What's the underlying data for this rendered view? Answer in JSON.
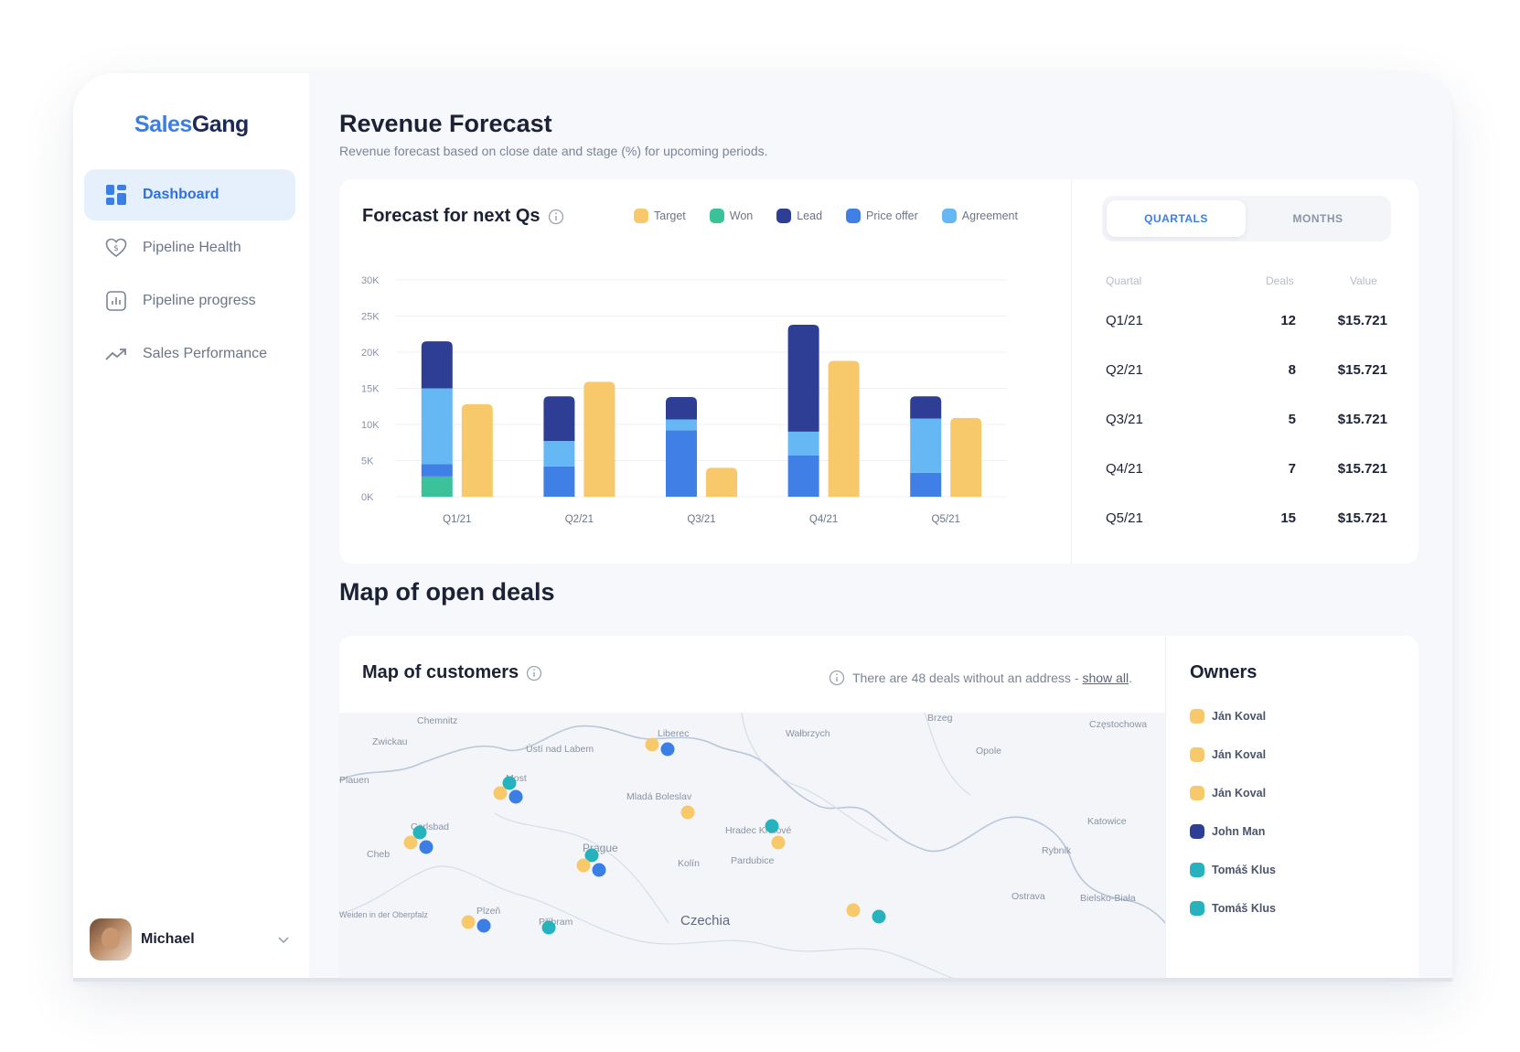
{
  "brand": {
    "part1": "Sales",
    "part2": "Gang"
  },
  "nav": [
    {
      "label": "Dashboard",
      "icon": "dashboard-icon",
      "active": true
    },
    {
      "label": "Pipeline Health",
      "icon": "heart-dollar-icon",
      "active": false
    },
    {
      "label": "Pipeline progress",
      "icon": "bar-chart-icon",
      "active": false
    },
    {
      "label": "Sales Performance",
      "icon": "trend-up-icon",
      "active": false
    }
  ],
  "user": {
    "name": "Michael"
  },
  "page": {
    "title": "Revenue Forecast",
    "subtitle": "Revenue forecast based on close date and stage (%) for upcoming periods."
  },
  "forecast": {
    "title": "Forecast for next Qs",
    "legend": [
      {
        "label": "Target",
        "color": "#f8c96b"
      },
      {
        "label": "Won",
        "color": "#3cc29a"
      },
      {
        "label": "Lead",
        "color": "#2f3e95"
      },
      {
        "label": "Price offer",
        "color": "#3f7fe6"
      },
      {
        "label": "Agreement",
        "color": "#66b8f5"
      }
    ],
    "toggle": {
      "on": "QUARTALS",
      "off": "MONTHS"
    },
    "table": {
      "headers": [
        "Quartal",
        "Deals",
        "Value"
      ],
      "rows": [
        {
          "q": "Q1/21",
          "deals": "12",
          "value": "$15.721"
        },
        {
          "q": "Q2/21",
          "deals": "8",
          "value": "$15.721"
        },
        {
          "q": "Q3/21",
          "deals": "5",
          "value": "$15.721"
        },
        {
          "q": "Q4/21",
          "deals": "7",
          "value": "$15.721"
        },
        {
          "q": "Q5/21",
          "deals": "15",
          "value": "$15.721"
        }
      ]
    }
  },
  "chart_data": {
    "type": "bar",
    "title": "Forecast for next Qs",
    "categories": [
      "Q1/21",
      "Q2/21",
      "Q3/21",
      "Q4/21",
      "Q5/21"
    ],
    "ytick_labels": [
      "0K",
      "5K",
      "10K",
      "15K",
      "20K",
      "25K",
      "30K"
    ],
    "ylim": [
      0,
      30000
    ],
    "stacked_series": [
      {
        "name": "Won",
        "color": "#3cc29a",
        "values": [
          2800,
          0,
          0,
          0,
          0
        ]
      },
      {
        "name": "Price offer",
        "color": "#3f7fe6",
        "values": [
          1700,
          4200,
          9200,
          5700,
          3300
        ]
      },
      {
        "name": "Agreement",
        "color": "#66b8f5",
        "values": [
          10500,
          3500,
          1500,
          3300,
          7500
        ]
      },
      {
        "name": "Lead",
        "color": "#2f3e95",
        "values": [
          6500,
          6200,
          3100,
          14800,
          3100
        ]
      }
    ],
    "target_series": {
      "name": "Target",
      "color": "#f8c96b",
      "values": [
        12800,
        15900,
        4000,
        18800,
        10900
      ]
    },
    "grid": true
  },
  "map": {
    "section_title": "Map of open deals",
    "card_title": "Map of customers",
    "note": "There are 48 deals without an address -",
    "note_link": "show all",
    "note_end": ".",
    "places": [
      "Chemnitz",
      "Zwickau",
      "Plauen",
      "Ústí nad Labem",
      "Liberec",
      "Most",
      "Mladá Boleslav",
      "Carlsbad",
      "Cheb",
      "Prague",
      "Kolín",
      "Hradec Králové",
      "Pardubice",
      "Wałbrzych",
      "Brzeg",
      "Opole",
      "Częstochowa",
      "Katowice",
      "Rybnik",
      "Ostrava",
      "Bielsko-Biała",
      "Plzeň",
      "Příbram",
      "Czechia",
      "Weiden in der Oberpfalz"
    ]
  },
  "owners": {
    "title": "Owners",
    "items": [
      {
        "name": "Ján Koval",
        "color": "#f8c96b"
      },
      {
        "name": "Ján Koval",
        "color": "#f8c96b"
      },
      {
        "name": "Ján Koval",
        "color": "#f8c96b"
      },
      {
        "name": "John Man",
        "color": "#2f3e95"
      },
      {
        "name": "Tomáš Klus",
        "color": "#26b3bd"
      },
      {
        "name": "Tomáš Klus",
        "color": "#26b3bd"
      }
    ]
  }
}
